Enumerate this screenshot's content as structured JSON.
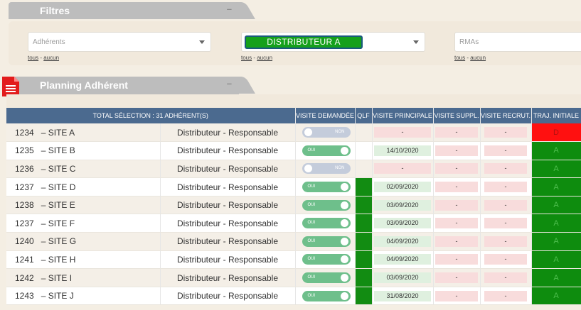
{
  "colors": {
    "accent_red": "#e21c1c",
    "header_blue": "#4b6a8f",
    "green": "#0e8c0e",
    "red": "#ff1010",
    "toggle_on": "#6ebf8b",
    "toggle_off": "#c4ccdb"
  },
  "filters": {
    "title": "Filtres",
    "collapse_icon": "–",
    "selects": [
      {
        "placeholder": "Adhérents",
        "value": "",
        "link_all": "tous",
        "link_none": "aucun"
      },
      {
        "placeholder": "",
        "value": "DISTRIBUTEUR A",
        "link_all": "tous",
        "link_none": "aucun"
      },
      {
        "placeholder": "RMAs",
        "value": "",
        "link_all": "tous",
        "link_none": "aucun"
      }
    ]
  },
  "planning": {
    "title": "Planning Adhérent",
    "collapse_icon": "–",
    "columns": {
      "total": "TOTAL SÉLECTION : 31 ADHÉRENT(S)",
      "visite_demandee": "VISITE DEMANDÉE",
      "qlf": "QLF",
      "visite_principale": "VISITE PRINCIPALE",
      "visite_suppl": "VISITE SUPPL.",
      "visite_recrut": "VISITE RECRUT.",
      "traj_initiale": "TRAJ. INITIALE"
    },
    "rows": [
      {
        "id": "1234",
        "site": "– SITE A",
        "role": "Distributeur - Responsable",
        "toggle": "NON",
        "on": false,
        "qlf": false,
        "principale": "-",
        "suppl": "-",
        "recrut": "-",
        "traj": "D",
        "traj_color": "red"
      },
      {
        "id": "1235",
        "site": "– SITE B",
        "role": "Distributeur - Responsable",
        "toggle": "OUI",
        "on": true,
        "qlf": false,
        "principale": "14/10/2020",
        "suppl": "-",
        "recrut": "-",
        "traj": "A",
        "traj_color": "green"
      },
      {
        "id": "1236",
        "site": "– SITE C",
        "role": "Distributeur - Responsable",
        "toggle": "NON",
        "on": false,
        "qlf": false,
        "principale": "-",
        "suppl": "-",
        "recrut": "-",
        "traj": "A",
        "traj_color": "green"
      },
      {
        "id": "1237",
        "site": "– SITE D",
        "role": "Distributeur - Responsable",
        "toggle": "OUI",
        "on": true,
        "qlf": true,
        "principale": "02/09/2020",
        "suppl": "-",
        "recrut": "-",
        "traj": "A",
        "traj_color": "green"
      },
      {
        "id": "1238",
        "site": "– SITE E",
        "role": "Distributeur - Responsable",
        "toggle": "OUI",
        "on": true,
        "qlf": true,
        "principale": "03/09/2020",
        "suppl": "-",
        "recrut": "-",
        "traj": "A",
        "traj_color": "green"
      },
      {
        "id": "1237",
        "site": "– SITE F",
        "role": "Distributeur - Responsable",
        "toggle": "OUI",
        "on": true,
        "qlf": true,
        "principale": "03/09/2020",
        "suppl": "-",
        "recrut": "-",
        "traj": "A",
        "traj_color": "green"
      },
      {
        "id": "1240",
        "site": "– SITE G",
        "role": "Distributeur - Responsable",
        "toggle": "OUI",
        "on": true,
        "qlf": true,
        "principale": "04/09/2020",
        "suppl": "-",
        "recrut": "-",
        "traj": "A",
        "traj_color": "green"
      },
      {
        "id": "1241",
        "site": "– SITE H",
        "role": "Distributeur - Responsable",
        "toggle": "OUI",
        "on": true,
        "qlf": true,
        "principale": "04/09/2020",
        "suppl": "-",
        "recrut": "-",
        "traj": "A",
        "traj_color": "green"
      },
      {
        "id": "1242",
        "site": "– SITE I",
        "role": "Distributeur - Responsable",
        "toggle": "OUI",
        "on": true,
        "qlf": true,
        "principale": "03/09/2020",
        "suppl": "-",
        "recrut": "-",
        "traj": "A",
        "traj_color": "green"
      },
      {
        "id": "1243",
        "site": "– SITE J",
        "role": "Distributeur - Responsable",
        "toggle": "OUI",
        "on": true,
        "qlf": true,
        "principale": "31/08/2020",
        "suppl": "-",
        "recrut": "-",
        "traj": "A",
        "traj_color": "green"
      }
    ]
  }
}
